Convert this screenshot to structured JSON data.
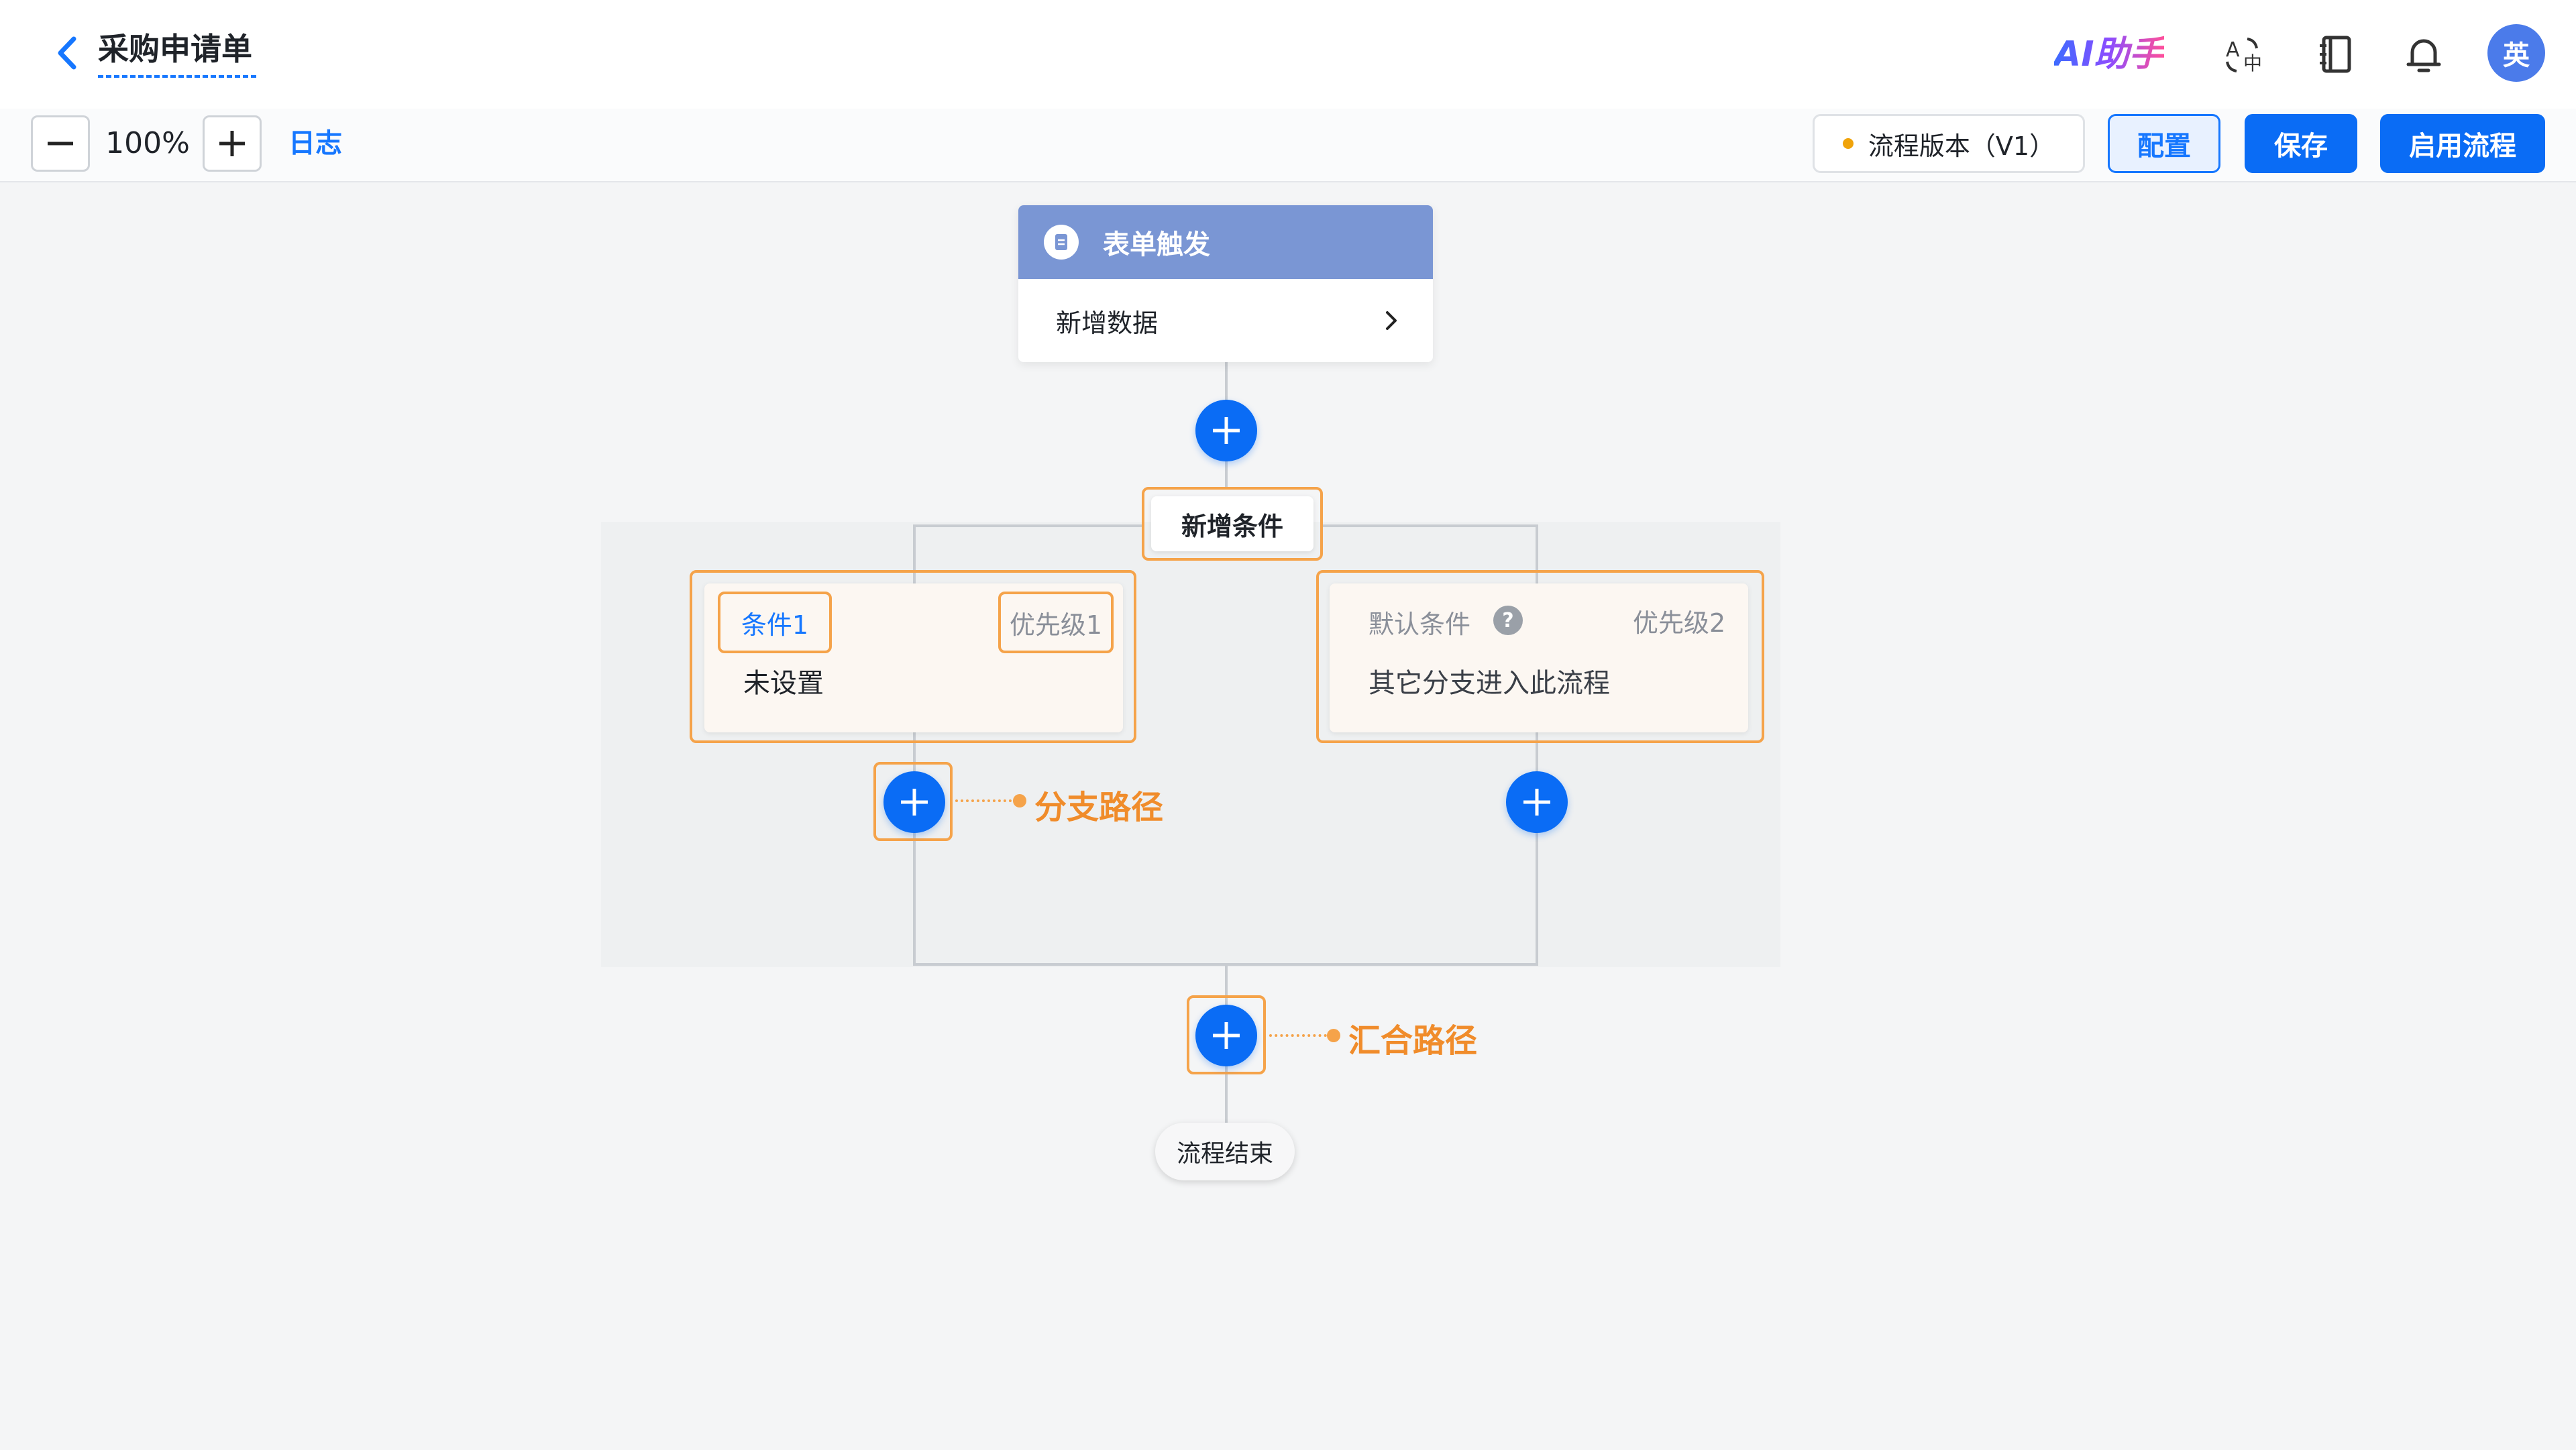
{
  "header": {
    "title": "采购申请单",
    "ai_assistant": "AI助手",
    "avatar_text": "英",
    "icons": [
      "back-arrow-icon",
      "translate-icon",
      "notebook-icon",
      "bell-icon"
    ]
  },
  "toolbar": {
    "zoom_value": "100%",
    "log_label": "日志",
    "version_label": "流程版本（V1）",
    "config_label": "配置",
    "save_label": "保存",
    "enable_label": "启用流程"
  },
  "flow": {
    "trigger": {
      "title": "表单触发",
      "action": "新增数据"
    },
    "add_condition_label": "新增条件",
    "branches": [
      {
        "tag": "条件1",
        "priority": "优先级1",
        "desc": "未设置"
      },
      {
        "tag": "默认条件",
        "priority": "优先级2",
        "desc": "其它分支进入此流程"
      }
    ],
    "annotations": {
      "branch_path": "分支路径",
      "merge_path": "汇合路径"
    },
    "end_label": "流程结束"
  },
  "colors": {
    "primary": "#0a6cf5",
    "highlight": "#f5a34a",
    "trigger_header": "#7a96d4"
  }
}
